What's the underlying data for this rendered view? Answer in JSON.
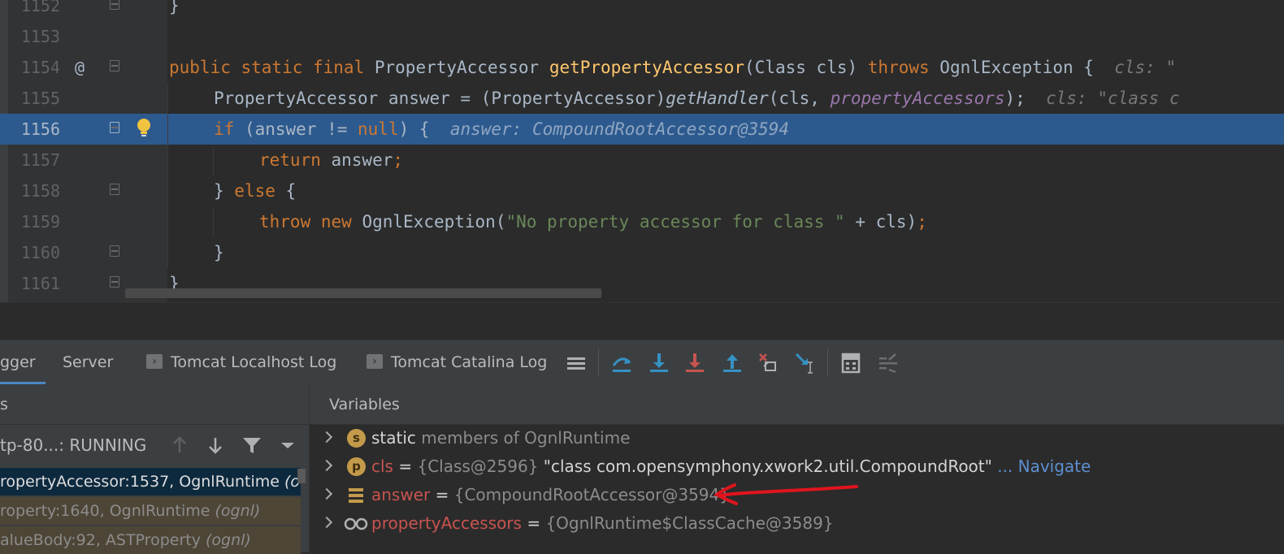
{
  "editor": {
    "lines": [
      {
        "num": "1152"
      },
      {
        "num": "1153"
      },
      {
        "num": "1154"
      },
      {
        "num": "1155"
      },
      {
        "num": "1156"
      },
      {
        "num": "1157"
      },
      {
        "num": "1158"
      },
      {
        "num": "1159"
      },
      {
        "num": "1160"
      },
      {
        "num": "1161"
      }
    ],
    "override_marker": "@",
    "code": {
      "l1152": "}",
      "l1154": {
        "kw": "public static final",
        "type": "PropertyAccessor",
        "fn": "getPropertyAccessor",
        "params": "(Class cls)",
        "throws": "throws",
        "exc": "OgnlException {",
        "hint": "cls: \""
      },
      "l1155": {
        "decl": "PropertyAccessor answer = (PropertyAccessor)",
        "call": "getHandler",
        "open": "(cls, ",
        "field": "propertyAccessors",
        "close": ");",
        "hint": "cls: \"class c"
      },
      "l1156": {
        "kw_if": "if",
        "cond_a": " (answer != ",
        "kw_null": "null",
        "cond_b": ") {",
        "hint": "answer: CompoundRootAccessor@3594"
      },
      "l1157": {
        "kw": "return",
        "rest": " answer",
        "semi": ";"
      },
      "l1158": {
        "brace": "} ",
        "kw": "else",
        "rest": " {"
      },
      "l1159": {
        "kw_throw": "throw",
        "kw_new": "new",
        "cls": " OgnlException(",
        "str": "\"No property accessor for class \"",
        "rest": " + cls)",
        "semi": ";"
      },
      "l1160": "}",
      "l1161": "}"
    }
  },
  "tabbar": {
    "tabs": [
      {
        "label": "gger",
        "active": true
      },
      {
        "label": "Server"
      },
      {
        "label": "Tomcat Localhost Log"
      },
      {
        "label": "Tomcat Catalina Log"
      }
    ],
    "toolbar_icons": [
      "show-execution-point-icon",
      "step-over-icon",
      "step-into-icon",
      "force-step-into-icon",
      "step-out-icon",
      "drop-frame-icon",
      "run-to-cursor-icon",
      "evaluate-expression-icon",
      "trace-icon"
    ]
  },
  "frames": {
    "header": "s",
    "thread": "tp-80...: RUNNING",
    "items": [
      {
        "method": "ropertyAccessor:1537, OgnlRuntime ",
        "pkg": "(o",
        "selected": true
      },
      {
        "method": "roperty:1640, OgnlRuntime ",
        "pkg": "(ognl)"
      },
      {
        "method": "alueBody:92, ASTProperty ",
        "pkg": "(ognl)"
      }
    ]
  },
  "variables": {
    "header": "Variables",
    "rows": [
      {
        "icon": "s",
        "name": "static",
        "desc": "members of OgnlRuntime"
      },
      {
        "icon": "p",
        "name": "cls",
        "eq": " = ",
        "ref": "{Class@2596}",
        "value": "\"class com.opensymphony.xwork2.util.CompoundRoot\"",
        "link": "... Navigate"
      },
      {
        "icon": "stack",
        "name": "answer",
        "eq": " = ",
        "ref": "{CompoundRootAccessor@3594}"
      },
      {
        "icon": "oo",
        "name": "propertyAccessors",
        "eq": " = ",
        "ref": "{OgnlRuntime$ClassCache@3589}"
      }
    ]
  },
  "colors": {
    "accent": "#4a88c7",
    "highlight_line": "#2d5a8e",
    "keyword": "#cc7832",
    "function": "#ffc66d",
    "string": "#6a8759",
    "field": "#9876aa",
    "var_name": "#c75450",
    "annotation_arrow": "#e0141e"
  }
}
